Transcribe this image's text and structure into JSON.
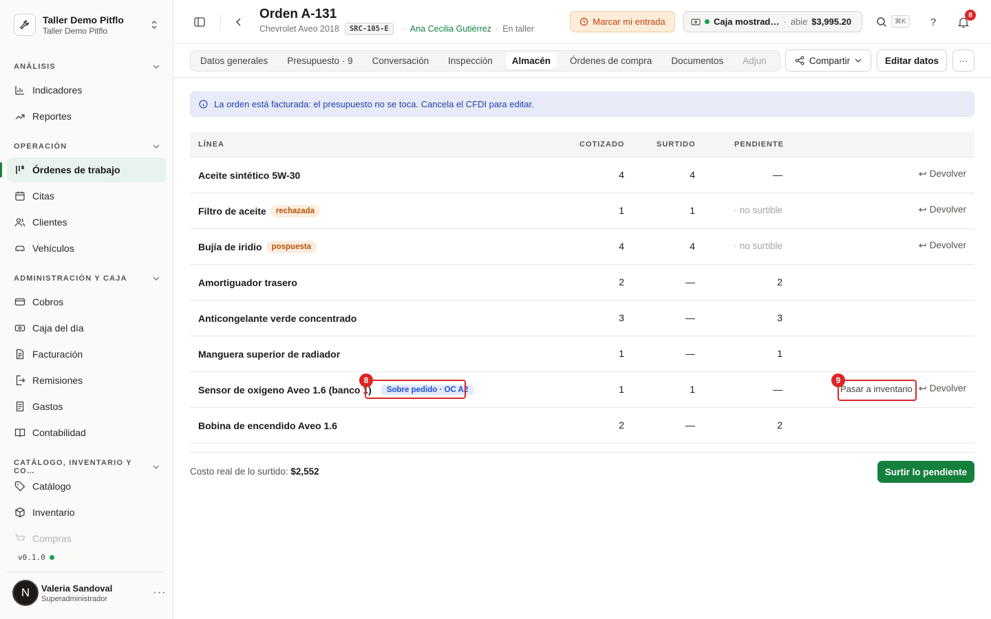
{
  "org": {
    "name": "Taller Demo Pitflo",
    "subtitle": "Taller Demo Pitflo"
  },
  "sidebar": {
    "sections": [
      {
        "title": "ANÁLISIS",
        "items": [
          {
            "label": "Indicadores",
            "icon": "bar-chart-icon"
          },
          {
            "label": "Reportes",
            "icon": "trend-icon"
          }
        ]
      },
      {
        "title": "OPERACIÓN",
        "items": [
          {
            "label": "Órdenes de trabajo",
            "icon": "kanban-icon",
            "active": true
          },
          {
            "label": "Citas",
            "icon": "calendar-icon"
          },
          {
            "label": "Clientes",
            "icon": "users-icon"
          },
          {
            "label": "Vehículos",
            "icon": "car-icon"
          }
        ]
      },
      {
        "title": "ADMINISTRACIÓN Y CAJA",
        "items": [
          {
            "label": "Cobros",
            "icon": "card-icon"
          },
          {
            "label": "Caja del día",
            "icon": "cash-icon"
          },
          {
            "label": "Facturación",
            "icon": "invoice-icon"
          },
          {
            "label": "Remisiones",
            "icon": "export-icon"
          },
          {
            "label": "Gastos",
            "icon": "receipt-icon"
          },
          {
            "label": "Contabilidad",
            "icon": "book-icon"
          }
        ]
      },
      {
        "title": "CATÁLOGO, INVENTARIO Y CO…",
        "items": [
          {
            "label": "Catálogo",
            "icon": "tag-icon"
          },
          {
            "label": "Inventario",
            "icon": "box-icon"
          },
          {
            "label": "Compras",
            "icon": "cart-icon"
          }
        ]
      }
    ],
    "version": "v0.1.0",
    "user": {
      "initial": "N",
      "name": "Valeria Sandoval",
      "role": "Superadministrador"
    }
  },
  "header": {
    "title": "Orden A-131",
    "vehicle": "Chevrolet Aveo 2018",
    "plate": "SRC-105-E",
    "customer": "Ana Cecilia Gutiérrez",
    "status": "En taller",
    "entrada_label": "Marcar mi entrada",
    "caja": {
      "name": "Caja mostrad…",
      "status": "abie",
      "amount": "$3,995.20"
    },
    "kbd": "⌘K",
    "help": "?",
    "notif_count": "8"
  },
  "tabs": {
    "items": [
      "Datos generales",
      "Presupuesto · 9",
      "Conversación",
      "Inspección",
      "Almacén",
      "Órdenes de compra",
      "Documentos",
      "Adjun"
    ],
    "active": "Almacén",
    "share_label": "Compartir",
    "edit_label": "Editar datos"
  },
  "alert": {
    "text": "La orden está facturada: el presupuesto no se toca. Cancela el CFDI para editar."
  },
  "table": {
    "headers": {
      "linea": "LÍNEA",
      "cotizado": "COTIZADO",
      "surtido": "SURTIDO",
      "pendiente": "PENDIENTE"
    },
    "devolver_label": "Devolver",
    "rows": [
      {
        "name": "Aceite sintético 5W-30",
        "cotizado": "4",
        "surtido": "4",
        "pendiente": "—",
        "devolver": true
      },
      {
        "name": "Filtro de aceite",
        "tag": "rechazada",
        "cotizado": "1",
        "surtido": "1",
        "pendiente_text": "· no surtible",
        "devolver": true
      },
      {
        "name": "Bujía de iridio",
        "tag": "pospuesta",
        "cotizado": "4",
        "surtido": "4",
        "pendiente_text": "· no surtible",
        "devolver": true
      },
      {
        "name": "Amortiguador trasero",
        "cotizado": "2",
        "surtido": "—",
        "pendiente": "2"
      },
      {
        "name": "Anticongelante verde concentrado",
        "cotizado": "3",
        "surtido": "—",
        "pendiente": "3"
      },
      {
        "name": "Manguera superior de radiador",
        "cotizado": "1",
        "surtido": "—",
        "pendiente": "1"
      },
      {
        "name": "Sensor de oxígeno Aveo 1.6 (banco 1)",
        "badge": "Sobre pedido · OC A2",
        "cotizado": "1",
        "surtido": "1",
        "pendiente": "—",
        "action": "Pasar a inventario",
        "devolver": true,
        "marker_badge": "8",
        "marker_action": "9"
      },
      {
        "name": "Bobina de encendido Aveo 1.6",
        "cotizado": "2",
        "surtido": "—",
        "pendiente": "2"
      }
    ]
  },
  "footer": {
    "costo_label": "Costo real de lo surtido:",
    "costo_value": "$2,552",
    "surtir_label": "Surtir lo pendiente"
  },
  "colors": {
    "accent": "#15803d",
    "highlight": "#dc2626",
    "alert_text": "#1e40af"
  }
}
